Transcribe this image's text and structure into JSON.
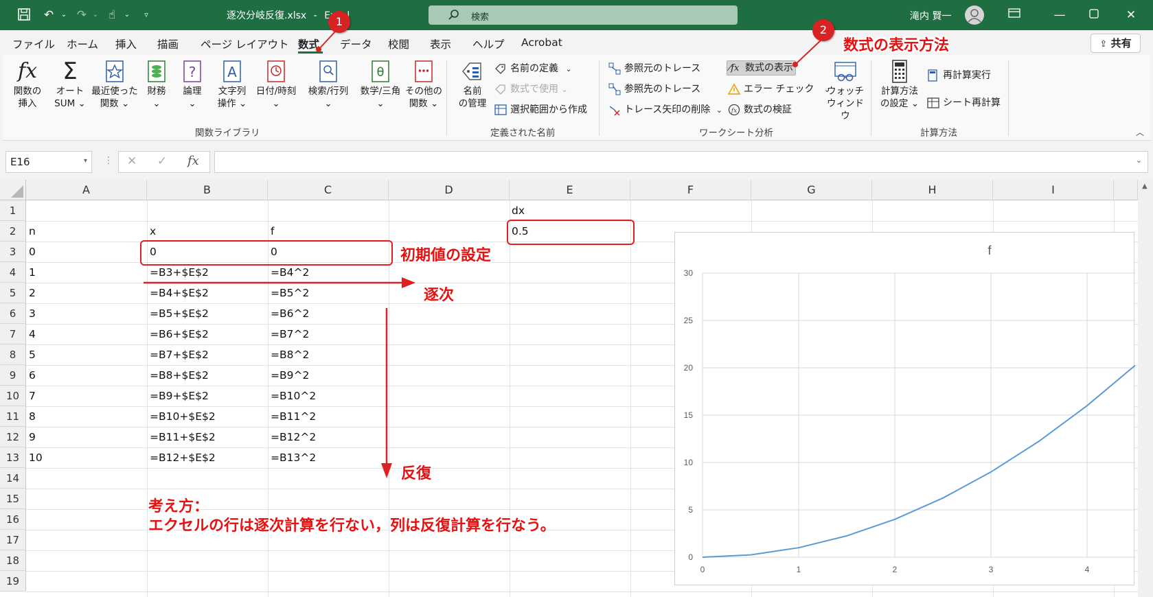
{
  "titlebar": {
    "filename": "逐次分岐反復.xlsx",
    "separator": "-",
    "app": "Excel",
    "search_placeholder": "検索",
    "user_name": "滝内 賢一"
  },
  "tabs": [
    "ファイル",
    "ホーム",
    "挿入",
    "描画",
    "ページ レイアウト",
    "数式",
    "データ",
    "校閲",
    "表示",
    "ヘルプ",
    "Acrobat"
  ],
  "active_tab": "数式",
  "share_label": "共有",
  "ribbon": {
    "function_library": {
      "label": "関数ライブラリ",
      "buttons": [
        {
          "line1": "関数の",
          "line2": "挿入",
          "icon": "fx-icon"
        },
        {
          "line1": "オート",
          "line2": "SUM ⌄",
          "icon": "sigma-icon"
        },
        {
          "line1": "最近使った",
          "line2": "関数 ⌄",
          "icon": "star-book-icon"
        },
        {
          "line1": "財務",
          "line2": "⌄",
          "icon": "coins-book-icon"
        },
        {
          "line1": "論理",
          "line2": "⌄",
          "icon": "question-book-icon"
        },
        {
          "line1": "文字列",
          "line2": "操作 ⌄",
          "icon": "text-book-icon"
        },
        {
          "line1": "日付/時刻",
          "line2": "⌄",
          "icon": "clock-book-icon"
        },
        {
          "line1": "検索/行列",
          "line2": "⌄",
          "icon": "magnifier-book-icon"
        },
        {
          "line1": "数学/三角",
          "line2": "⌄",
          "icon": "theta-book-icon"
        },
        {
          "line1": "その他の",
          "line2": "関数 ⌄",
          "icon": "dots-book-icon"
        }
      ]
    },
    "defined_names": {
      "label": "定義された名前",
      "manager_line1": "名前",
      "manager_line2": "の管理",
      "define_name": "名前の定義",
      "use_in_formula": "数式で使用",
      "create_from_selection": "選択範囲から作成"
    },
    "formula_auditing": {
      "label": "ワークシート分析",
      "trace_precedents": "参照元のトレース",
      "trace_dependents": "参照先のトレース",
      "remove_arrows": "トレース矢印の削除",
      "show_formulas": "数式の表示",
      "error_checking": "エラー チェック",
      "evaluate_formula": "数式の検証",
      "watch_line1": "ウォッチ",
      "watch_line2": "ウィンドウ"
    },
    "calculation": {
      "label": "計算方法",
      "options_line1": "計算方法",
      "options_line2": "の設定 ⌄",
      "calc_now": "再計算実行",
      "calc_sheet": "シート再計算"
    }
  },
  "formula_bar": {
    "name_box": "E16",
    "formula": ""
  },
  "grid": {
    "columns": [
      "A",
      "B",
      "C",
      "D",
      "E",
      "F",
      "G",
      "H",
      "I"
    ],
    "rows": [
      "1",
      "2",
      "3",
      "4",
      "5",
      "6",
      "7",
      "8",
      "9",
      "10",
      "11",
      "12",
      "13",
      "14",
      "15",
      "16",
      "17",
      "18",
      "19"
    ],
    "E1": "dx",
    "E2": "0.5",
    "A2": "n",
    "B2": "x",
    "C2": "f",
    "A3": "0",
    "B3": "0",
    "C3": "0",
    "A_values": [
      "1",
      "2",
      "3",
      "4",
      "5",
      "6",
      "7",
      "8",
      "9",
      "10"
    ],
    "B_formulas": [
      "=B3+$E$2",
      "=B4+$E$2",
      "=B5+$E$2",
      "=B6+$E$2",
      "=B7+$E$2",
      "=B8+$E$2",
      "=B9+$E$2",
      "=B10+$E$2",
      "=B11+$E$2",
      "=B12+$E$2"
    ],
    "C_formulas": [
      "=B4^2",
      "=B5^2",
      "=B6^2",
      "=B7^2",
      "=B8^2",
      "=B9^2",
      "=B10^2",
      "=B11^2",
      "=B12^2",
      "=B13^2"
    ]
  },
  "annotations": {
    "badge1": "1",
    "badge2": "2",
    "show_formula_method": "数式の表示方法",
    "initial_value": "初期値の設定",
    "sequential": "逐次",
    "iteration": "反復",
    "thinking_line1": "考え方：",
    "thinking_line2": "エクセルの行は逐次計算を行ない，列は反復計算を行なう。"
  },
  "chart_data": {
    "type": "line",
    "title": "f",
    "xlabel": "",
    "ylabel": "",
    "x": [
      0,
      0.5,
      1,
      1.5,
      2,
      2.5,
      3,
      3.5,
      4,
      4.5
    ],
    "series": [
      {
        "values": [
          0,
          0.25,
          1,
          2.25,
          4,
          6.25,
          9,
          12.25,
          16,
          20.25
        ]
      }
    ],
    "xlim": [
      0,
      4.5
    ],
    "ylim": [
      0,
      30
    ],
    "x_ticks": [
      "0",
      "1",
      "2",
      "3",
      "4"
    ],
    "y_ticks": [
      "0",
      "5",
      "10",
      "15",
      "20",
      "25",
      "30"
    ],
    "grid": true,
    "line_color": "#5b9bd5"
  }
}
